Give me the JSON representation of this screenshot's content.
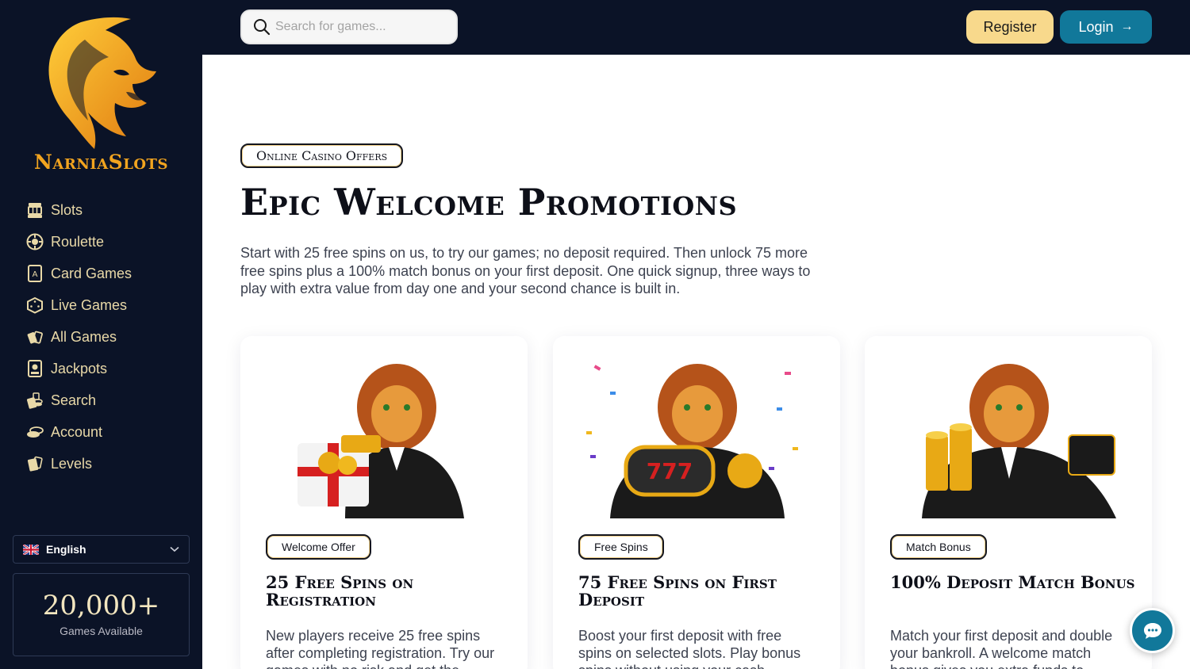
{
  "brand": {
    "name": "NarniaSlots",
    "logo_icon": "lion-head-logo",
    "accent": "#f2a41f"
  },
  "sidebar": {
    "items": [
      {
        "label": "Slots",
        "icon": "slot-machine-icon"
      },
      {
        "label": "Roulette",
        "icon": "roulette-icon"
      },
      {
        "label": "Card Games",
        "icon": "playing-card-icon"
      },
      {
        "label": "Live Games",
        "icon": "dice-icon"
      },
      {
        "label": "All Games",
        "icon": "cards-fan-icon"
      },
      {
        "label": "Jackpots",
        "icon": "jackpot-icon"
      },
      {
        "label": "Search",
        "icon": "chips-icon"
      },
      {
        "label": "Account",
        "icon": "coins-icon"
      },
      {
        "label": "Levels",
        "icon": "card-stack-icon"
      }
    ],
    "language": {
      "label": "English",
      "icon": "uk-flag-icon"
    },
    "games_count": {
      "value": "20,000+",
      "label": "Games Available"
    }
  },
  "topbar": {
    "search_placeholder": "Search for games...",
    "register_label": "Register",
    "login_label": "Login",
    "login_icon": "arrow-right-icon"
  },
  "hero": {
    "eyebrow": "Online Casino Offers",
    "title": "Epic Welcome Promotions",
    "description": "Start with 25 free spins on us, to try our games; no deposit required. Then unlock 75 more free spins plus a 100% match bonus on your first deposit. One quick signup, three ways to play with extra value from day one and your second chance is built in."
  },
  "cards": [
    {
      "tag": "Welcome Offer",
      "title": "25 Free Spins on Registration",
      "description": "New players receive 25 free spins after completing registration. Try our games with no risk and get the",
      "art": "lion-gift-box-illustration"
    },
    {
      "tag": "Free Spins",
      "title": "75 Free Spins on First Deposit",
      "description": "Boost your first deposit with free spins on selected slots. Play bonus spins without using your cash",
      "art": "lion-slot-reel-illustration"
    },
    {
      "tag": "Match Bonus",
      "title": "100% Deposit Match Bonus",
      "description": "Match your first deposit and double your bankroll. A welcome match bonus gives you extra funds to",
      "art": "lion-gold-coins-illustration"
    }
  ],
  "chat": {
    "icon": "chat-bubble-icon"
  },
  "colors": {
    "sidebar_bg": "#0b1327",
    "register_bg": "#f8d98c",
    "login_bg": "#11789a",
    "nav_text": "#e9d9a8"
  }
}
